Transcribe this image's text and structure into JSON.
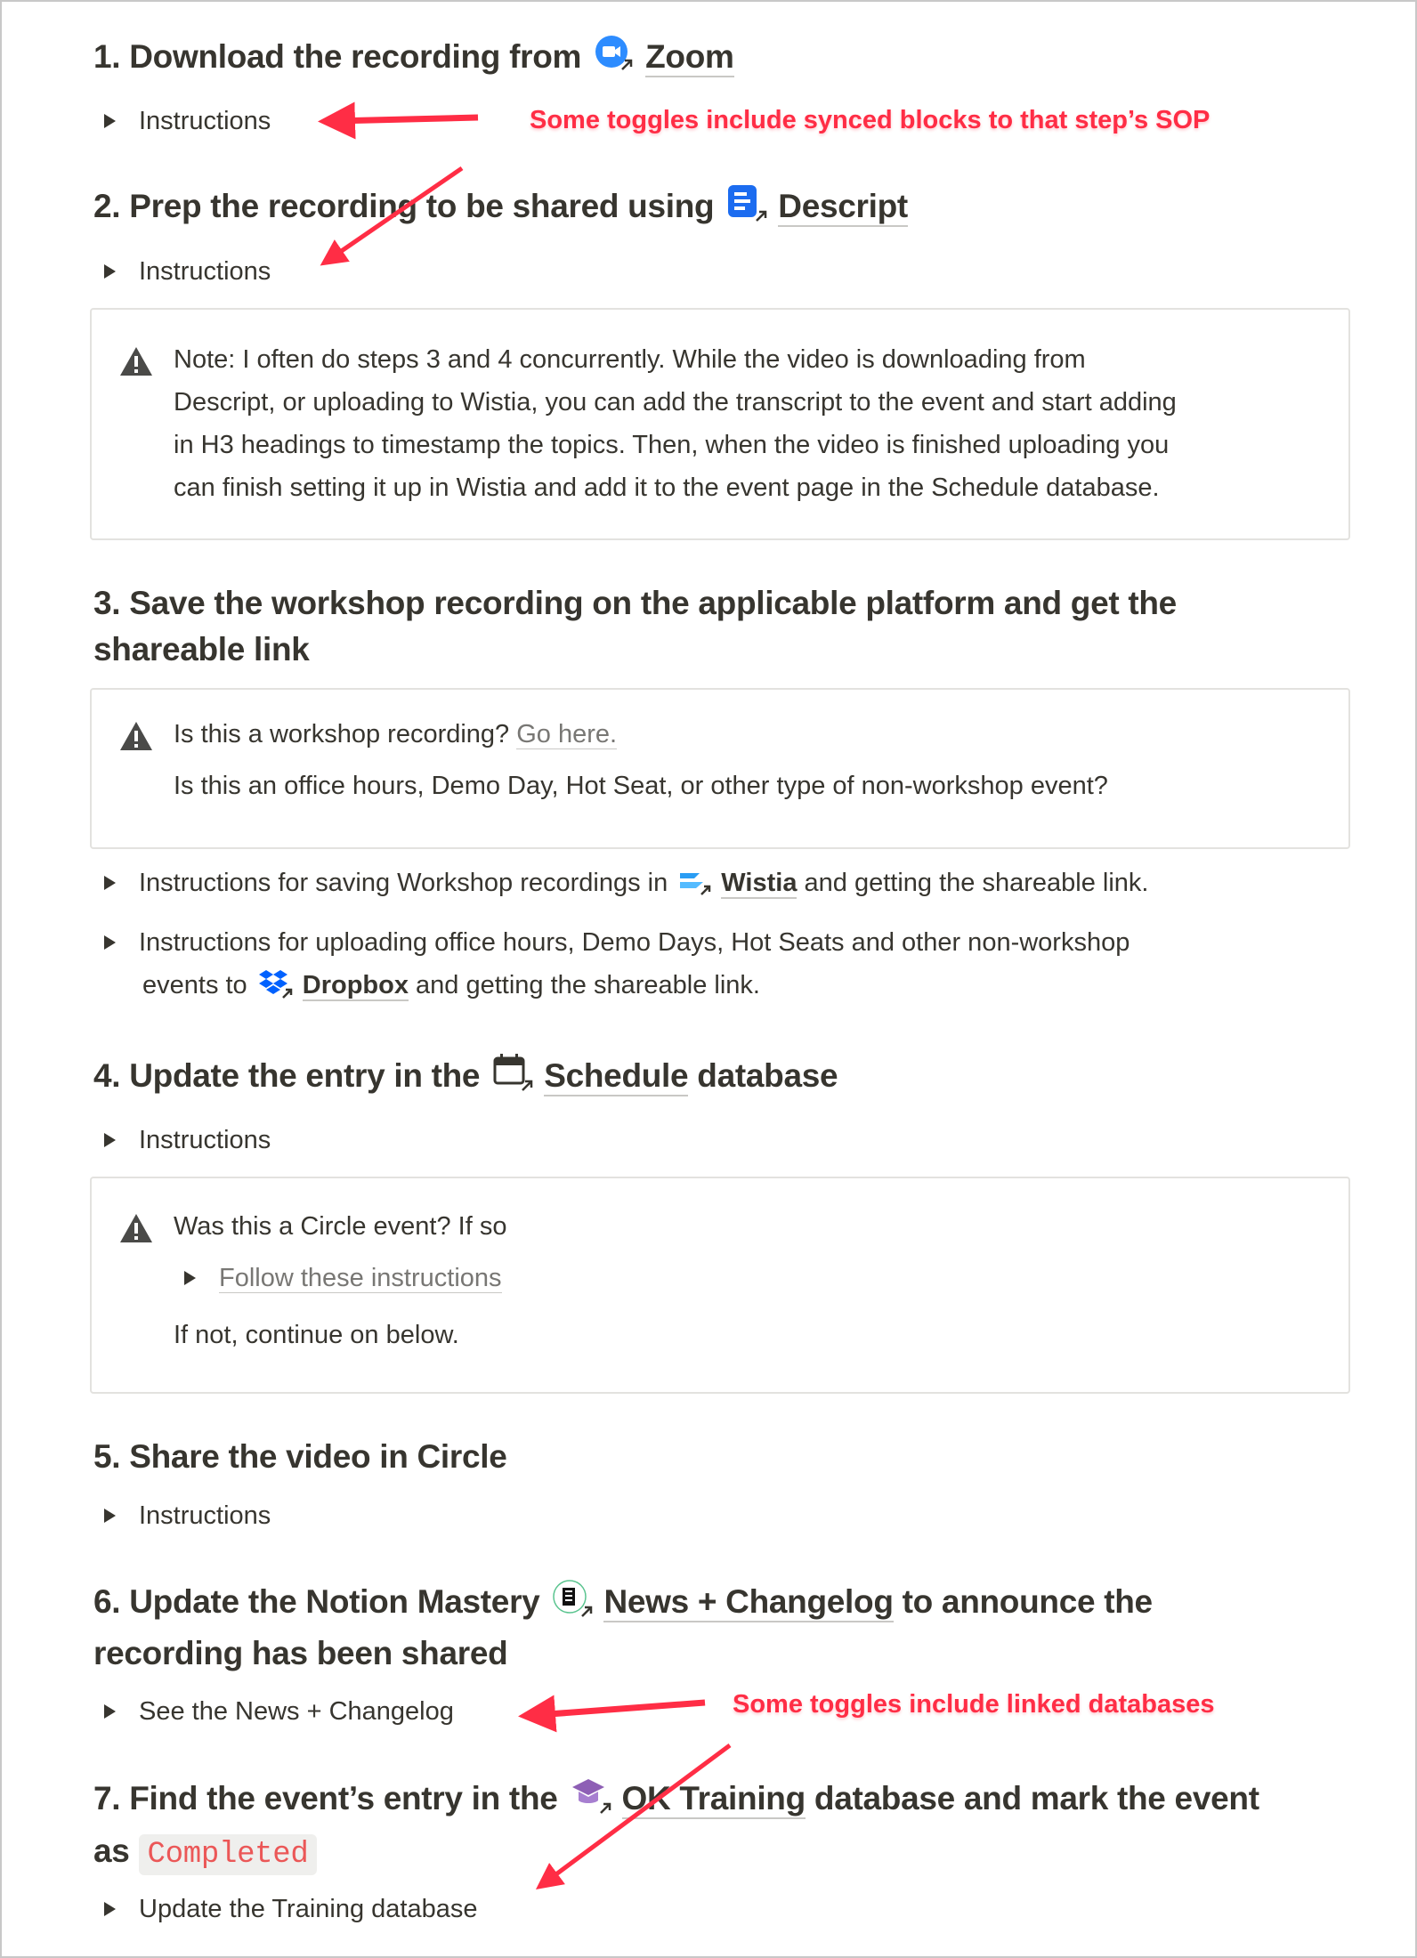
{
  "steps": [
    {
      "prefix": "1. Download the recording from",
      "link": "Zoom",
      "icon": "zoom-icon",
      "toggle": "Instructions"
    },
    {
      "prefix": "2. Prep the recording to be shared using",
      "link": "Descript",
      "icon": "descript-icon",
      "toggle": "Instructions"
    },
    {
      "line1": "3. Save the workshop recording on the applicable platform and get the",
      "line2": "shareable link"
    },
    {
      "prefix": "4. Update the entry in the",
      "link": "Schedule",
      "suffix": "database",
      "icon": "calendar-icon",
      "toggle": "Instructions"
    },
    {
      "title": "5. Share the video in Circle",
      "toggle": "Instructions"
    },
    {
      "prefix": "6. Update the Notion Mastery",
      "link": "News + Changelog",
      "suffix": "to announce the",
      "line2": "recording has been shared",
      "icon": "newspaper-icon",
      "toggle": "See the News + Changelog"
    },
    {
      "prefix": "7. Find the event’s entry in the",
      "link": "OK Training",
      "suffix": "database and mark the event",
      "line2_prefix": "as",
      "badge": "Completed",
      "icon": "graduation-cap-icon",
      "toggle": "Update the Training database"
    }
  ],
  "callout_note": {
    "lines": [
      "Note: I often do steps 3 and 4 concurrently. While the video is downloading from",
      "Descript, or uploading to Wistia, you can add the transcript to the event and start adding",
      "in H3 headings to timestamp the topics. Then, when the video is finished uploading you",
      "can finish setting it up in Wistia and add it to the event page in the Schedule database."
    ]
  },
  "callout_platform": {
    "q1": "Is this a workshop recording?",
    "q1_link": "Go here.",
    "q2": "Is this an office hours, Demo Day, Hot Seat, or other type of non-workshop event?"
  },
  "toggle_wistia": {
    "prefix": "Instructions for saving Workshop recordings in",
    "link": "Wistia",
    "suffix": "and getting the shareable link."
  },
  "toggle_dropbox": {
    "line1": "Instructions for uploading office hours, Demo Days, Hot Seats and other non-workshop",
    "prefix": "events to",
    "link": "Dropbox",
    "suffix": "and getting the shareable link."
  },
  "callout_circle": {
    "q": "Was this a Circle event? If so",
    "toggle": "Follow these instructions",
    "after": "If not, continue on below."
  },
  "annotations": {
    "synced": "Some toggles include synced blocks to that step’s SOP",
    "linked": "Some toggles include linked databases"
  },
  "colors": {
    "annotation": "#ff2d45",
    "text": "#37352f",
    "badge_text": "#eb5757",
    "badge_bg": "#efefed"
  }
}
